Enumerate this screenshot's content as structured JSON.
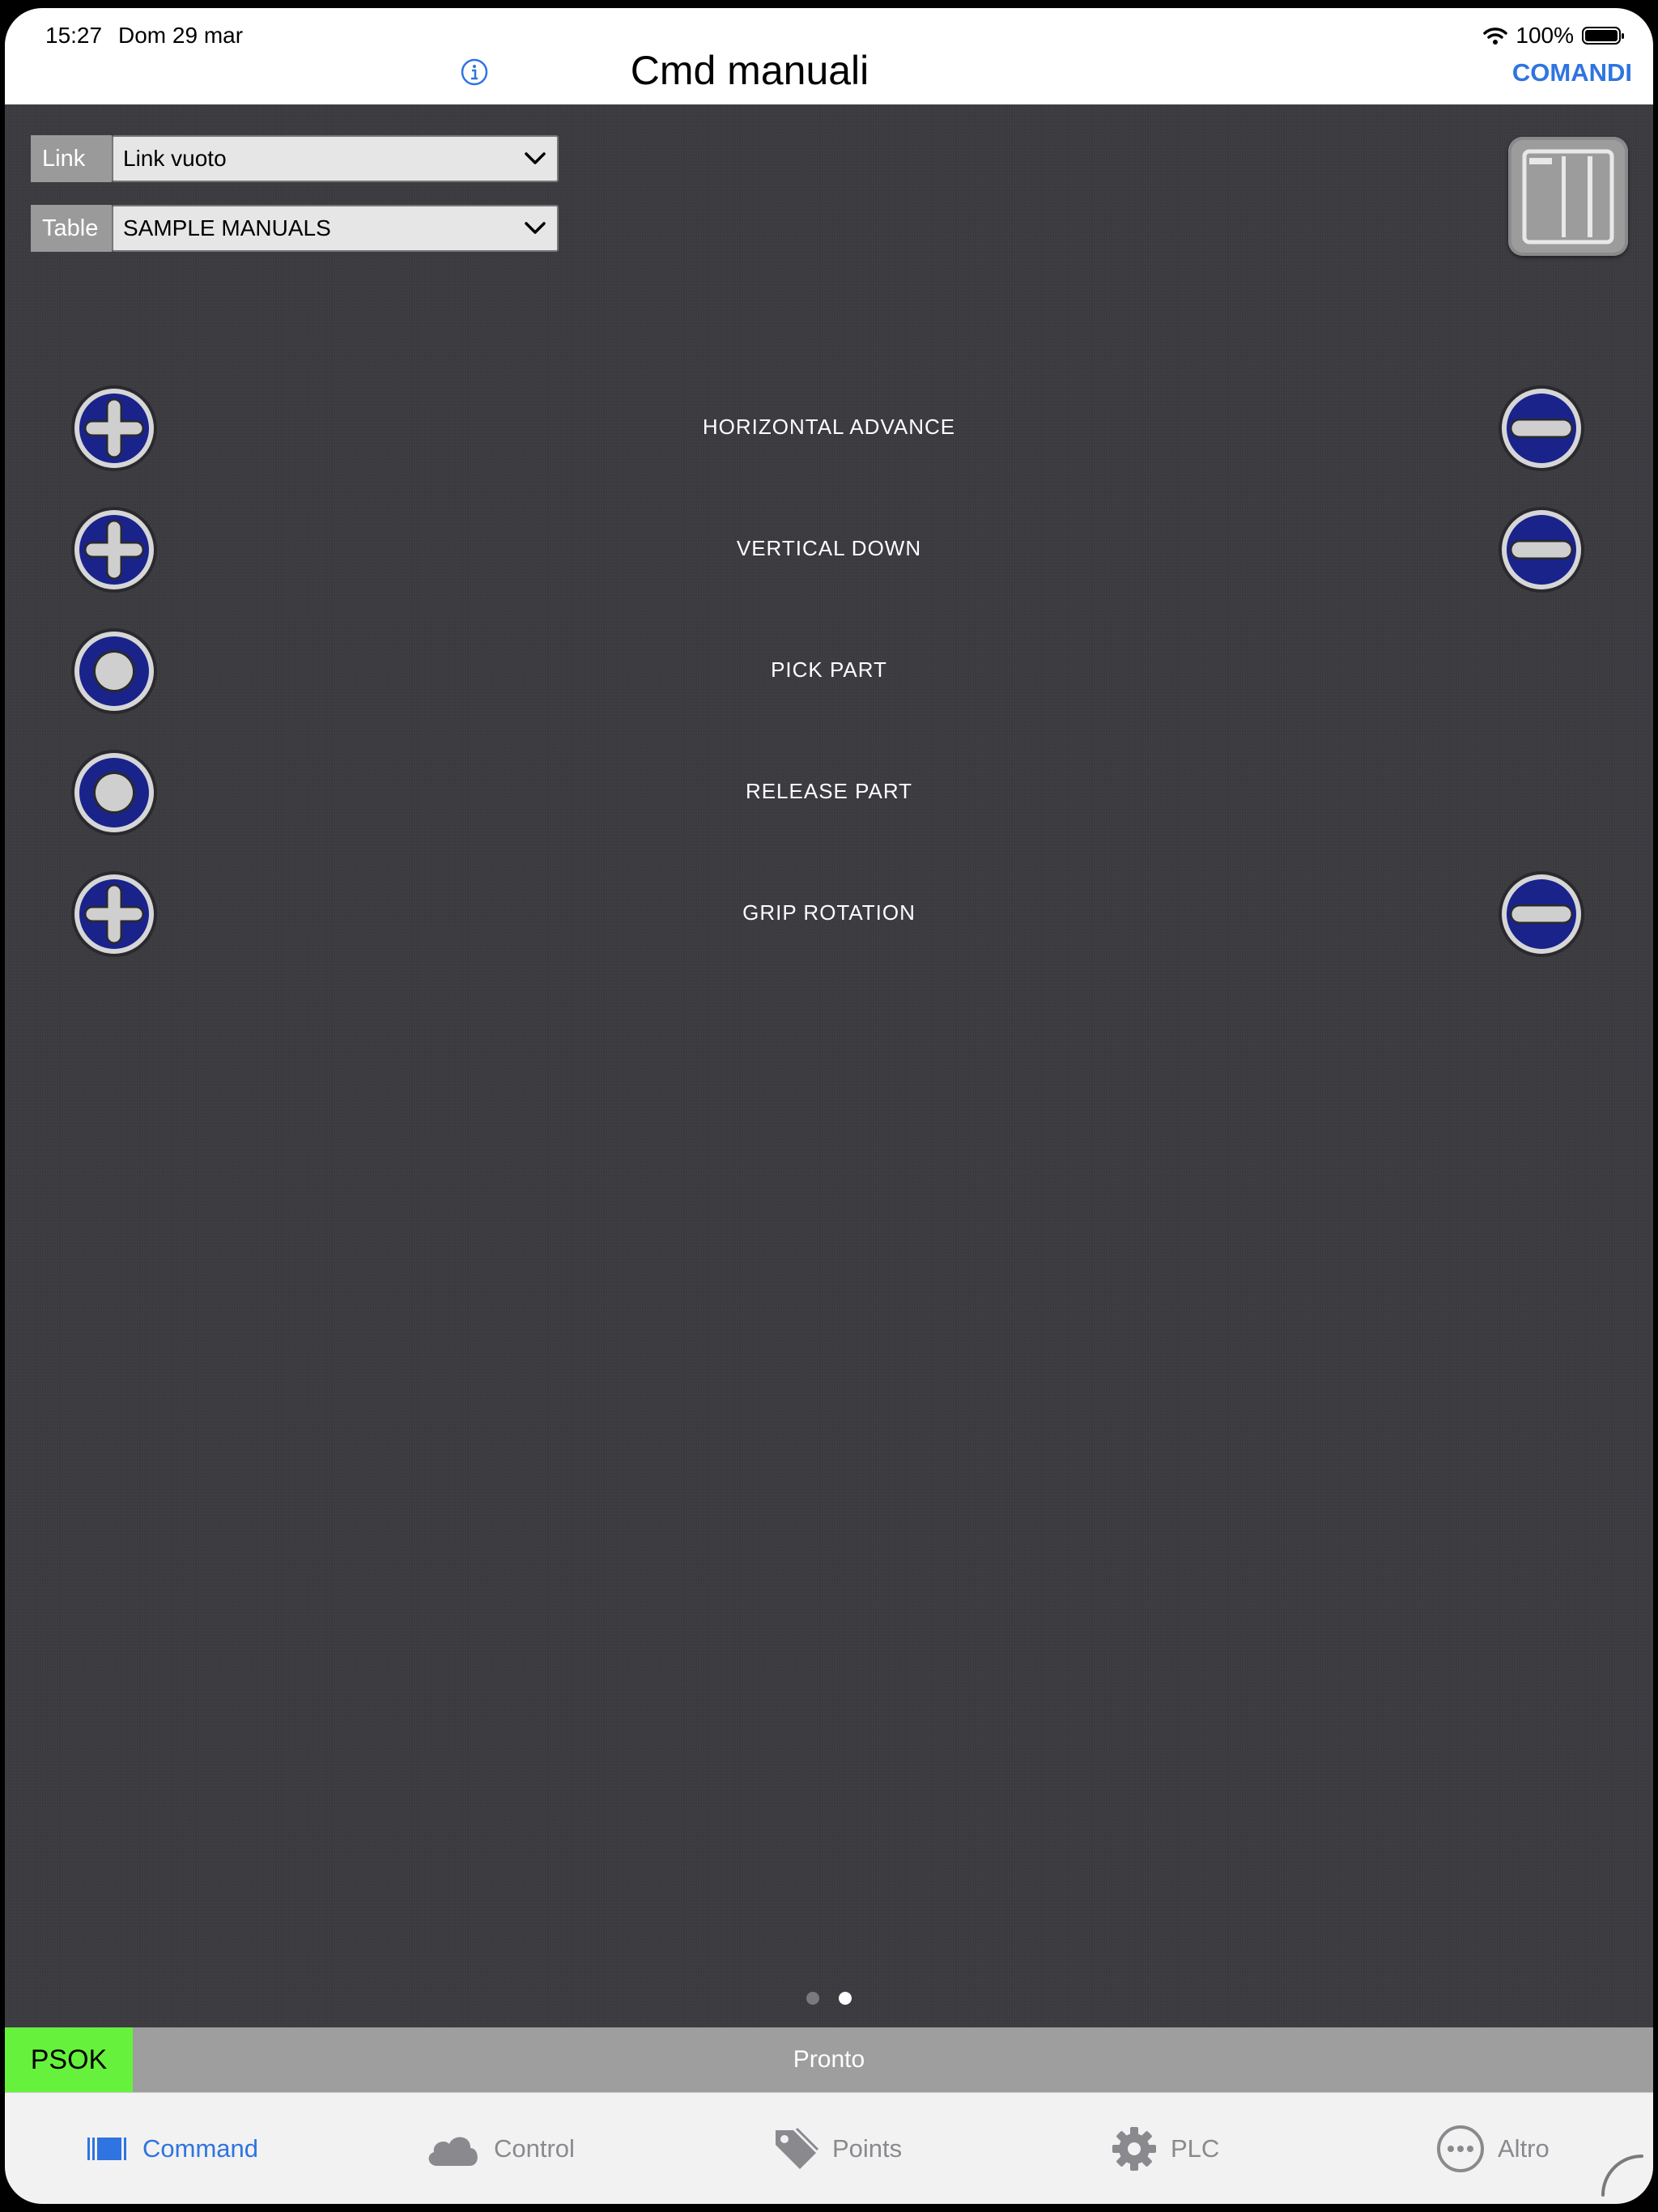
{
  "status_bar": {
    "time": "15:27",
    "date": "Dom 29 mar",
    "battery": "100%"
  },
  "nav": {
    "title": "Cmd manuali",
    "right_action": "COMANDI",
    "accent_color": "#2f74e0"
  },
  "selectors": {
    "link": {
      "label": "Link",
      "value": "Link vuoto"
    },
    "table": {
      "label": "Table",
      "value": "SAMPLE MANUALS"
    }
  },
  "commands": [
    {
      "label": "HORIZONTAL ADVANCE",
      "left_icon": "plus-icon",
      "right_icon": "minus-icon"
    },
    {
      "label": "VERTICAL DOWN",
      "left_icon": "plus-icon",
      "right_icon": "minus-icon"
    },
    {
      "label": "PICK PART",
      "left_icon": "dot-icon",
      "right_icon": null
    },
    {
      "label": "RELEASE PART",
      "left_icon": "dot-icon",
      "right_icon": null
    },
    {
      "label": "GRIP ROTATION",
      "left_icon": "plus-icon",
      "right_icon": "minus-icon"
    }
  ],
  "pagination": {
    "pages": 2,
    "current": 2
  },
  "status": {
    "code": "PSOK",
    "message": "Pronto",
    "code_color": "#66f23c"
  },
  "tabs": [
    {
      "label": "Command",
      "icon": "command-icon",
      "active": true
    },
    {
      "label": "Control",
      "icon": "cloud-icon",
      "active": false
    },
    {
      "label": "Points",
      "icon": "tag-icon",
      "active": false
    },
    {
      "label": "PLC",
      "icon": "gear-icon",
      "active": false
    },
    {
      "label": "Altro",
      "icon": "more-icon",
      "active": false
    }
  ]
}
